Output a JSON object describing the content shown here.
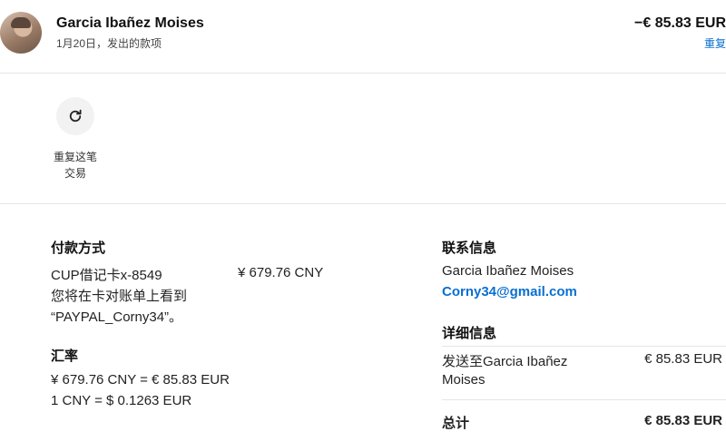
{
  "header": {
    "name": "Garcia Ibañez Moises",
    "subtitle": "1月20日，发出的款项",
    "amount": "−€ 85.83 EUR",
    "amount_link": "重复"
  },
  "actions": {
    "repeat_label_line1": "重复这笔",
    "repeat_label_line2": "交易"
  },
  "payment": {
    "title": "付款方式",
    "card": "CUP借记卡x-8549",
    "card_amount": "¥ 679.76 CNY",
    "statement_line1": "您将在卡对账单上看到",
    "statement_line2": "“PAYPAL_Corny34”。"
  },
  "exchange": {
    "title": "汇率",
    "line1": "¥ 679.76 CNY = € 85.83 EUR",
    "line2": "1 CNY = $ 0.1263 EUR"
  },
  "contact": {
    "title": "联系信息",
    "name": "Garcia Ibañez Moises",
    "email": "Corny34@gmail.com"
  },
  "details": {
    "title": "详细信息",
    "sent_to_line1": "发送至Garcia Ibañez",
    "sent_to_line2": "Moises",
    "sent_amount": "€ 85.83 EUR",
    "total_label": "总计",
    "total_amount": "€ 85.83 EUR"
  }
}
